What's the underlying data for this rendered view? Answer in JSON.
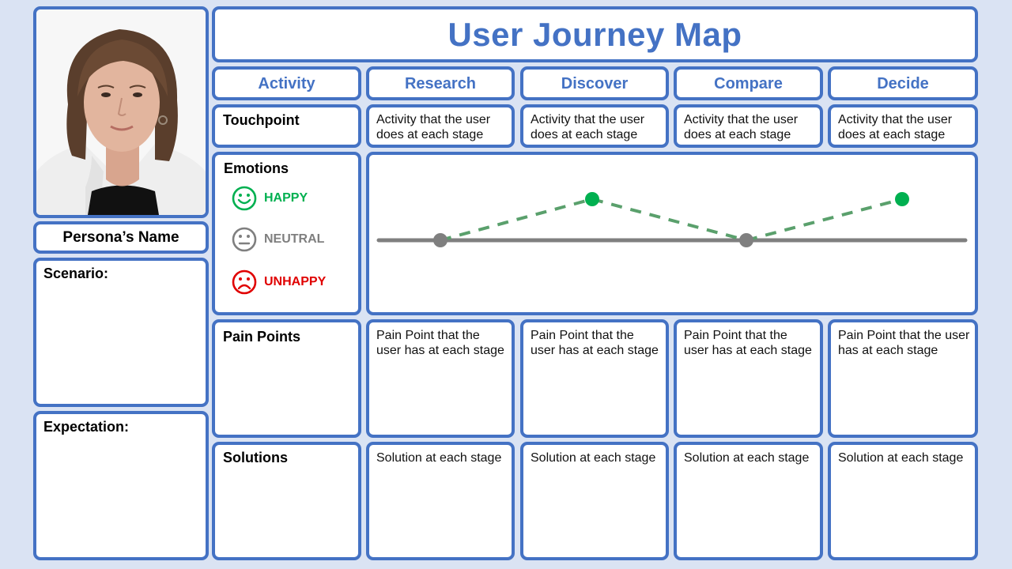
{
  "title": "User Journey Map",
  "persona": {
    "photo_alt": "persona-photo",
    "name": "Persona’s Name",
    "scenario_label": "Scenario:",
    "expectation_label": "Expectation:"
  },
  "header": {
    "activity_label": "Activity",
    "stages": [
      "Research",
      "Discover",
      "Compare",
      "Decide"
    ]
  },
  "rows": {
    "touchpoint": {
      "label": "Touchpoint",
      "cells": [
        "Activity that the user does at each stage",
        "Activity that the user does at each stage",
        "Activity that the user does at each stage",
        "Activity that the user does at each stage"
      ]
    },
    "emotions": {
      "label": "Emotions",
      "legend": [
        {
          "key": "happy",
          "label": "HAPPY",
          "icon": "smile-icon",
          "color": "#00b050"
        },
        {
          "key": "neutral",
          "label": "NEUTRAL",
          "icon": "neutral-face-icon",
          "color": "#7f7f7f"
        },
        {
          "key": "unhappy",
          "label": "UNHAPPY",
          "icon": "frown-icon",
          "color": "#e00000"
        }
      ]
    },
    "pain_points": {
      "label": "Pain Points",
      "cells": [
        "Pain Point that the user has at each stage",
        "Pain Point that the user has at each stage",
        "Pain Point that the user has at each stage",
        "Pain Point that the user has at each stage"
      ]
    },
    "solutions": {
      "label": "Solutions",
      "cells": [
        "Solution at each stage",
        "Solution at each stage",
        "Solution at each stage",
        "Solution at each stage"
      ]
    }
  },
  "chart_data": {
    "type": "line",
    "title": "Emotions",
    "categories": [
      "Research",
      "Discover",
      "Compare",
      "Decide"
    ],
    "levels": [
      "unhappy",
      "neutral",
      "happy"
    ],
    "values": [
      "neutral",
      "happy",
      "neutral",
      "happy"
    ],
    "numeric_values": [
      0,
      1,
      0,
      1
    ],
    "ylim": [
      -1,
      1
    ],
    "baseline": "neutral",
    "colors": {
      "happy": "#00b050",
      "neutral": "#7f7f7f",
      "unhappy": "#e00000",
      "line_dash": "#5aa06c"
    }
  },
  "colors": {
    "accent": "#4472c4",
    "background": "#dae3f3"
  }
}
